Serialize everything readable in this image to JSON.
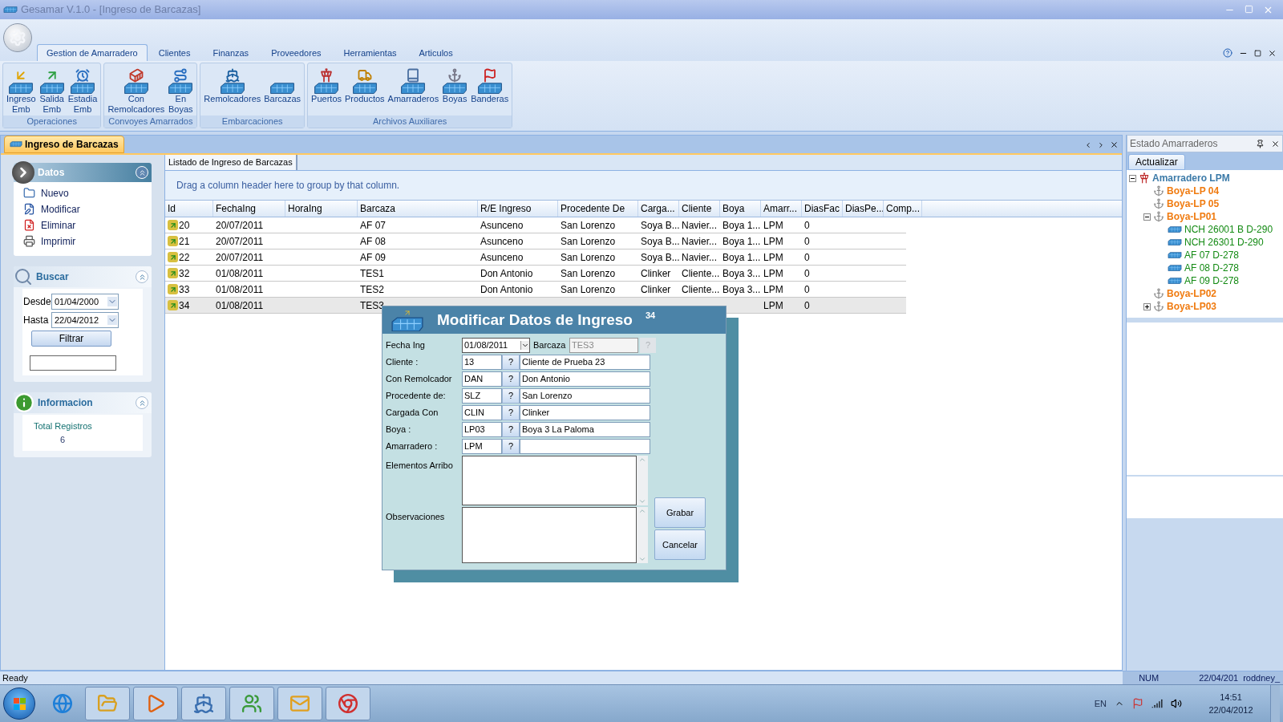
{
  "window": {
    "title": "Gesamar V.1.0 - [Ingreso de Barcazas]"
  },
  "ribbon_tabs": [
    {
      "label": "Gestion de Amarradero",
      "selected": true
    },
    {
      "label": "Clientes",
      "selected": false
    },
    {
      "label": "Finanzas",
      "selected": false
    },
    {
      "label": "Proveedores",
      "selected": false
    },
    {
      "label": "Herramientas",
      "selected": false
    },
    {
      "label": "Articulos",
      "selected": false
    }
  ],
  "ribbon_groups": [
    {
      "label": "Operaciones",
      "buttons": [
        "Ingreso\nEmb",
        "Salida\nEmb",
        "Estadia\nEmb"
      ]
    },
    {
      "label": "Convoyes Amarrados",
      "buttons": [
        "Con\nRemolcadores",
        "En\nBoyas"
      ]
    },
    {
      "label": "Embarcaciones",
      "buttons": [
        "Remolcadores",
        "Barcazas"
      ]
    },
    {
      "label": "Archivos Auxiliares",
      "buttons": [
        "Puertos",
        "Productos",
        "Amarraderos",
        "Boyas",
        "Banderas"
      ]
    }
  ],
  "document_tab": {
    "label": "Ingreso de Barcazas"
  },
  "sidebar": {
    "datos": {
      "title": "Datos",
      "items": [
        "Nuevo",
        "Modificar",
        "Eliminar",
        "Imprimir"
      ]
    },
    "buscar": {
      "title": "Buscar",
      "desde_label": "Desde",
      "desde": "01/04/2000",
      "hasta_label": "Hasta",
      "hasta": "22/04/2012",
      "filter_button": "Filtrar"
    },
    "informacion": {
      "title": "Informacion",
      "label": "Total Registros",
      "value": "6"
    }
  },
  "grid": {
    "tab": "Listado de Ingreso de Barcazas",
    "group_hint": "Drag a column header here to group by that column.",
    "columns": [
      "Id",
      "FechaIng",
      "HoraIng",
      "Barcaza",
      "R/E Ingreso",
      "Procedente De",
      "Carga...",
      "Cliente",
      "Boya",
      "Amarr...",
      "DiasFac",
      "DiasPe...",
      "Comp..."
    ],
    "rows": [
      {
        "selected": false,
        "id": "20",
        "fecha_ing": "20/07/2011",
        "barcaza": "AF 07",
        "re_ingreso": "Asunceno",
        "procedente": "San Lorenzo",
        "carga": "Soya B...",
        "cliente": "Navier...",
        "boya": "Boya 1...",
        "amarradero": "LPM",
        "dias_fac": "0"
      },
      {
        "selected": false,
        "id": "21",
        "fecha_ing": "20/07/2011",
        "barcaza": "AF 08",
        "re_ingreso": "Asunceno",
        "procedente": "San Lorenzo",
        "carga": "Soya B...",
        "cliente": "Navier...",
        "boya": "Boya 1...",
        "amarradero": "LPM",
        "dias_fac": "0"
      },
      {
        "selected": false,
        "id": "22",
        "fecha_ing": "20/07/2011",
        "barcaza": "AF 09",
        "re_ingreso": "Asunceno",
        "procedente": "San Lorenzo",
        "carga": "Soya B...",
        "cliente": "Navier...",
        "boya": "Boya 1...",
        "amarradero": "LPM",
        "dias_fac": "0"
      },
      {
        "selected": false,
        "id": "32",
        "fecha_ing": "01/08/2011",
        "barcaza": "TES1",
        "re_ingreso": "Don Antonio",
        "procedente": "San Lorenzo",
        "carga": "Clinker",
        "cliente": "Cliente...",
        "boya": "Boya 3...",
        "amarradero": "LPM",
        "dias_fac": "0"
      },
      {
        "selected": false,
        "id": "33",
        "fecha_ing": "01/08/2011",
        "barcaza": "TES2",
        "re_ingreso": "Don Antonio",
        "procedente": "San Lorenzo",
        "carga": "Clinker",
        "cliente": "Cliente...",
        "boya": "Boya 3...",
        "amarradero": "LPM",
        "dias_fac": "0"
      },
      {
        "selected": true,
        "id": "34",
        "fecha_ing": "01/08/2011",
        "barcaza": "TES3",
        "amarradero": "LPM",
        "dias_fac": "0"
      }
    ]
  },
  "dialog": {
    "title": "Modificar Datos de Ingreso",
    "record_id": "34",
    "fecha": {
      "label": "Fecha Ing",
      "value": "01/08/2011"
    },
    "barcaza": {
      "label": "Barcaza",
      "value": "TES3",
      "lookup_button": "?",
      "disabled": true
    },
    "fields": [
      {
        "label": "Cliente :",
        "code": "13",
        "lookup_button": "?",
        "name": "Cliente de Prueba 23"
      },
      {
        "label": "Con Remolcador",
        "code": "DAN",
        "lookup_button": "?",
        "name": "Don Antonio"
      },
      {
        "label": "Procedente de:",
        "code": "SLZ",
        "lookup_button": "?",
        "name": "San Lorenzo"
      },
      {
        "label": "Cargada Con",
        "code": "CLIN",
        "lookup_button": "?",
        "name": "Clinker"
      },
      {
        "label": "Boya :",
        "code": "LP03",
        "lookup_button": "?",
        "name": "Boya 3 La Paloma"
      },
      {
        "label": "Amarradero :",
        "code": "LPM",
        "lookup_button": "?"
      }
    ],
    "elementos_label": "Elementos Arribo",
    "observaciones_label": "Observaciones",
    "buttons": [
      "Grabar",
      "Cancelar"
    ]
  },
  "right_panel": {
    "title": "Estado Amarraderos",
    "refresh_button": "Actualizar",
    "tree": [
      {
        "kind": "amarradero",
        "label": "Amarradero LPM",
        "expanded": true,
        "children": [
          {
            "kind": "boya",
            "label": "Boya-LP 04"
          },
          {
            "kind": "boya",
            "label": "Boya-LP 05"
          },
          {
            "kind": "boya",
            "label": "Boya-LP01",
            "expanded": true,
            "children": [
              {
                "kind": "barcaza",
                "label": "NCH 26001 B D-290"
              },
              {
                "kind": "barcaza",
                "label": "NCH 26301 D-290"
              },
              {
                "kind": "barcaza",
                "label": "AF 07 D-278"
              },
              {
                "kind": "barcaza",
                "label": "AF 08 D-278"
              },
              {
                "kind": "barcaza",
                "label": "AF 09 D-278"
              }
            ]
          },
          {
            "kind": "boya",
            "label": "Boya-LP02"
          },
          {
            "kind": "boya",
            "label": "Boya-LP03",
            "expanded": false
          }
        ]
      }
    ]
  },
  "status_bar": {
    "text": "Ready",
    "num": "NUM",
    "date": "22/04/201",
    "user": "roddney_"
  },
  "taskbar": {
    "language": "EN",
    "time": "14:51",
    "date": "22/04/2012"
  }
}
